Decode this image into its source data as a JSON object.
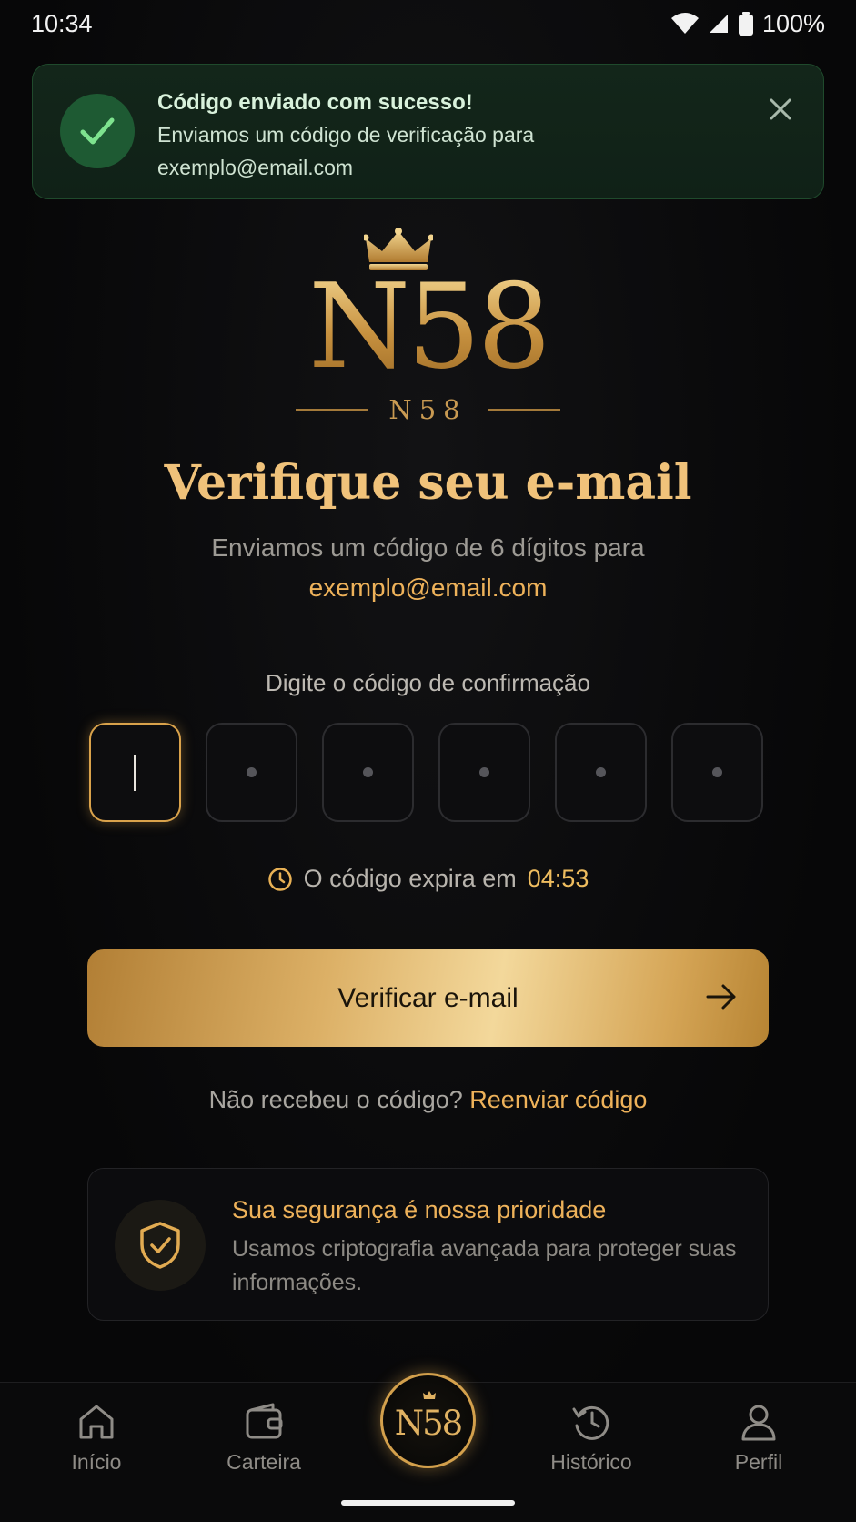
{
  "status_bar": {
    "time": "10:34",
    "battery": "100%"
  },
  "toast": {
    "title": "Código enviado com sucesso!",
    "message_line1": "Enviamos um código de verificação para",
    "message_line2": "exemplo@email.com",
    "icons": {
      "check": "check-icon",
      "close": "close-icon"
    }
  },
  "logo": {
    "main": "N58",
    "sub": "N58"
  },
  "heading": "Verifique seu e-mail",
  "subtitle": "Enviamos um código de 6 dígitos para",
  "email": "exemplo@email.com",
  "code": {
    "label": "Digite o código de confirmação",
    "length": 6,
    "filled": 0
  },
  "timer": {
    "prefix": "O código expira em",
    "value": "04:53",
    "icon": "clock-icon"
  },
  "verify_button": {
    "label": "Verificar e-mail",
    "icon": "arrow-right-icon"
  },
  "resend": {
    "text": "Não recebeu o código?",
    "link": "Reenviar código"
  },
  "security": {
    "title": "Sua segurança é nossa prioridade",
    "text": "Usamos criptografia avançada para proteger suas informações.",
    "icon": "shield-check-icon"
  },
  "bottom_nav": {
    "items": [
      {
        "label": "Início",
        "icon": "home-icon"
      },
      {
        "label": "Carteira",
        "icon": "wallet-icon"
      },
      {
        "label": "N58",
        "icon": "crown-icon"
      },
      {
        "label": "Histórico",
        "icon": "history-icon"
      },
      {
        "label": "Perfil",
        "icon": "user-icon"
      }
    ]
  },
  "colors": {
    "gold": "#eeb25a",
    "success_bg": "#13261a",
    "background": "#070708"
  }
}
